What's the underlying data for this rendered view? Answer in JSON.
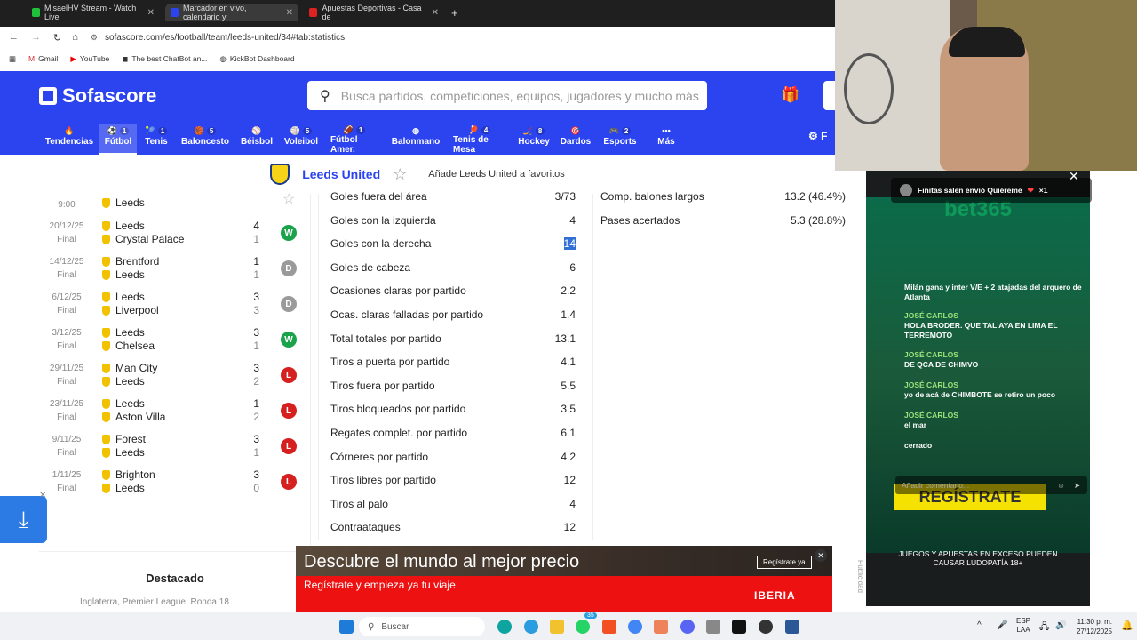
{
  "browser": {
    "tabs": [
      {
        "title": "MisaelHV Stream - Watch Live",
        "color": "#1ec23b"
      },
      {
        "title": "Marcador en vivo, calendario y",
        "color": "#2c44f0"
      },
      {
        "title": "Apuestas Deportivas - Casa de",
        "color": "#d22"
      }
    ],
    "url": "sofascore.com/es/football/team/leeds-united/34#tab:statistics",
    "bookmarks": [
      "Gmail",
      "YouTube",
      "The best ChatBot an...",
      "KickBot Dashboard"
    ]
  },
  "header": {
    "brand": "Sofascore",
    "search_placeholder": "Busca partidos, competiciones, equipos, jugadores y mucho más",
    "nav": [
      {
        "label": "Tendencias",
        "count": ""
      },
      {
        "label": "Fútbol",
        "count": "1"
      },
      {
        "label": "Tenis",
        "count": "1"
      },
      {
        "label": "Baloncesto",
        "count": "5"
      },
      {
        "label": "Béisbol",
        "count": ""
      },
      {
        "label": "Voleibol",
        "count": "5"
      },
      {
        "label": "Fútbol Amer.",
        "count": "1"
      },
      {
        "label": "Balonmano",
        "count": ""
      },
      {
        "label": "Tenis de Mesa",
        "count": "4"
      },
      {
        "label": "Hockey",
        "count": "8"
      },
      {
        "label": "Dardos",
        "count": ""
      },
      {
        "label": "Esports",
        "count": "2"
      },
      {
        "label": "Más",
        "count": ""
      }
    ],
    "partial_right": "F"
  },
  "team": {
    "name": "Leeds United",
    "favorite_text": "Añade Leeds United a favoritos"
  },
  "matches": [
    {
      "date": "9:00",
      "status": "",
      "home": "",
      "away": "Leeds",
      "hs": "",
      "as": "",
      "result": ""
    },
    {
      "date": "20/12/25",
      "status": "Final",
      "home": "Leeds",
      "away": "Crystal Palace",
      "hs": "4",
      "as": "1",
      "result": "W"
    },
    {
      "date": "14/12/25",
      "status": "Final",
      "home": "Brentford",
      "away": "Leeds",
      "hs": "1",
      "as": "1",
      "result": "D"
    },
    {
      "date": "6/12/25",
      "status": "Final",
      "home": "Leeds",
      "away": "Liverpool",
      "hs": "3",
      "as": "3",
      "result": "D"
    },
    {
      "date": "3/12/25",
      "status": "Final",
      "home": "Leeds",
      "away": "Chelsea",
      "hs": "3",
      "as": "1",
      "result": "W"
    },
    {
      "date": "29/11/25",
      "status": "Final",
      "home": "Man City",
      "away": "Leeds",
      "hs": "3",
      "as": "2",
      "result": "L"
    },
    {
      "date": "23/11/25",
      "status": "Final",
      "home": "Leeds",
      "away": "Aston Villa",
      "hs": "1",
      "as": "2",
      "result": "L"
    },
    {
      "date": "9/11/25",
      "status": "Final",
      "home": "Forest",
      "away": "Leeds",
      "hs": "3",
      "as": "1",
      "result": "L"
    },
    {
      "date": "1/11/25",
      "status": "Final",
      "home": "Brighton",
      "away": "Leeds",
      "hs": "3",
      "as": "0",
      "result": "L"
    }
  ],
  "stats_left": [
    {
      "label": "Goles fuera del área",
      "value": "3/73"
    },
    {
      "label": "Goles con la izquierda",
      "value": "4"
    },
    {
      "label": "Goles con la derecha",
      "value": "14"
    },
    {
      "label": "Goles de cabeza",
      "value": "6"
    },
    {
      "label": "Ocasiones claras por partido",
      "value": "2.2"
    },
    {
      "label": "Ocas. claras falladas por partido",
      "value": "1.4"
    },
    {
      "label": "Total totales por partido",
      "value": "13.1"
    },
    {
      "label": "Tiros a puerta por partido",
      "value": "4.1"
    },
    {
      "label": "Tiros fuera por partido",
      "value": "5.5"
    },
    {
      "label": "Tiros bloqueados por partido",
      "value": "3.5"
    },
    {
      "label": "Regates complet. por partido",
      "value": "6.1"
    },
    {
      "label": "Córneres por partido",
      "value": "4.2"
    },
    {
      "label": "Tiros libres por partido",
      "value": "12"
    },
    {
      "label": "Tiros al palo",
      "value": "4"
    },
    {
      "label": "Contraataques",
      "value": "12"
    }
  ],
  "stats_right": [
    {
      "label": "Comp. balones largos",
      "value": "13.2 (46.4%)"
    },
    {
      "label": "Pases acertados",
      "value": "5.3 (28.8%)"
    }
  ],
  "featured": {
    "title": "Destacado",
    "sub": "Inglaterra, Premier League, Ronda 18"
  },
  "ad": {
    "headline": "Descubre el mundo al mejor precio",
    "sub": "Regístrate y empieza ya tu viaje",
    "cta": "Regístrate ya",
    "brand": "IBERIA",
    "side": "Publicidad"
  },
  "chat": {
    "gift": "Finitas salen envió Quiéreme",
    "gift_count": "×1",
    "banner": "bet365",
    "messages": [
      {
        "user": "",
        "text": "Milán gana y inter V/E + 2 atajadas del arquero de Atlanta"
      },
      {
        "user": "JOSÉ CARLOS",
        "text": "HOLA BRODER. QUE TAL AYA EN LIMA EL TERREMOTO"
      },
      {
        "user": "JOSÉ CARLOS",
        "text": "DE QCA DE CHIMVO"
      },
      {
        "user": "JOSÉ CARLOS",
        "text": "yo de acá de CHIMBOTE se retiro un poco"
      },
      {
        "user": "JOSÉ CARLOS",
        "text": "el mar"
      },
      {
        "user": "",
        "text": "cerrado"
      }
    ],
    "input_placeholder": "Añadir comentario...",
    "register": "REGÍSTRATE",
    "disclaimer": "JUEGOS Y APUESTAS EN EXCESO PUEDEN CAUSAR LUDOPATÍA 18+"
  },
  "taskbar": {
    "search": "Buscar",
    "lang": "ESP",
    "lang2": "LAA",
    "time": "11:30 p. m.",
    "date": "27/12/2025",
    "badge": "35"
  }
}
